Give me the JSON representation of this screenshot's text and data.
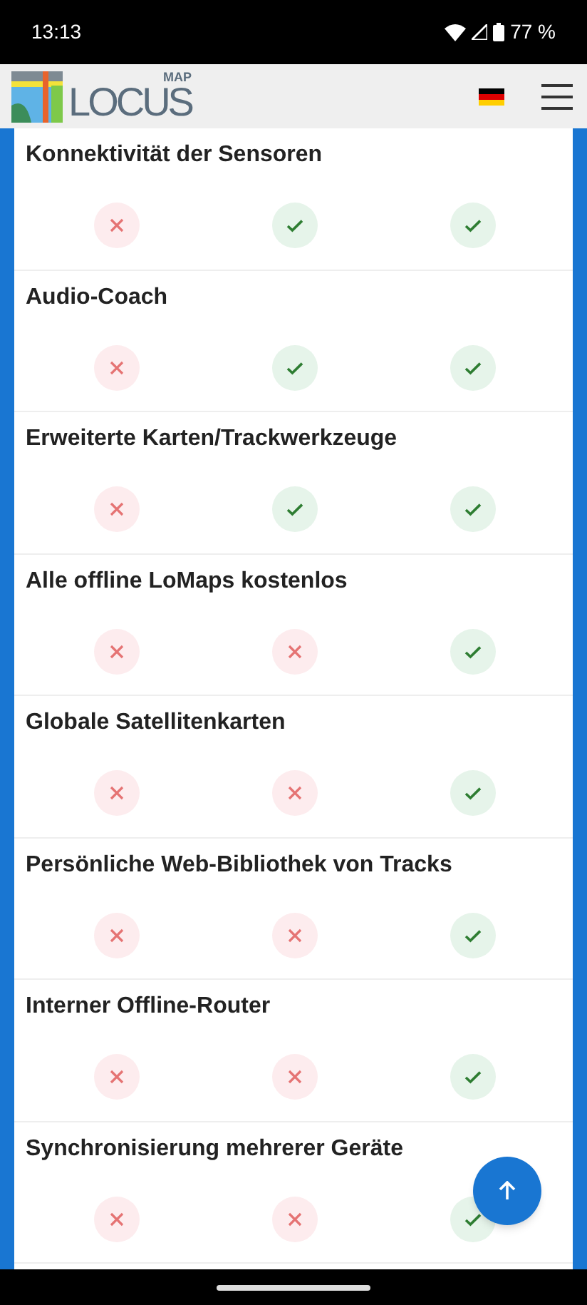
{
  "status_bar": {
    "time": "13:13",
    "battery": "77 %"
  },
  "header": {
    "logo_text": "LOCUS",
    "logo_sup": "MAP"
  },
  "features": [
    {
      "title": "Konnektivität der Sensoren",
      "cells": [
        {
          "included": false
        },
        {
          "included": true
        },
        {
          "included": true
        }
      ]
    },
    {
      "title": "Audio-Coach",
      "cells": [
        {
          "included": false
        },
        {
          "included": true
        },
        {
          "included": true
        }
      ]
    },
    {
      "title": "Erweiterte Karten/Trackwerkzeuge",
      "cells": [
        {
          "included": false
        },
        {
          "included": true
        },
        {
          "included": true
        }
      ]
    },
    {
      "title": "Alle offline LoMaps kostenlos",
      "cells": [
        {
          "included": false
        },
        {
          "included": false
        },
        {
          "included": true
        }
      ]
    },
    {
      "title": "Globale Satellitenkarten",
      "cells": [
        {
          "included": false
        },
        {
          "included": false
        },
        {
          "included": true
        }
      ]
    },
    {
      "title": "Persönliche Web-Bibliothek von Tracks",
      "cells": [
        {
          "included": false
        },
        {
          "included": false
        },
        {
          "included": true
        }
      ]
    },
    {
      "title": "Interner Offline-Router",
      "cells": [
        {
          "included": false
        },
        {
          "included": false
        },
        {
          "included": true
        }
      ]
    },
    {
      "title": "Synchronisierung mehrerer Geräte",
      "cells": [
        {
          "included": false
        },
        {
          "included": false
        },
        {
          "included": true
        }
      ]
    }
  ]
}
